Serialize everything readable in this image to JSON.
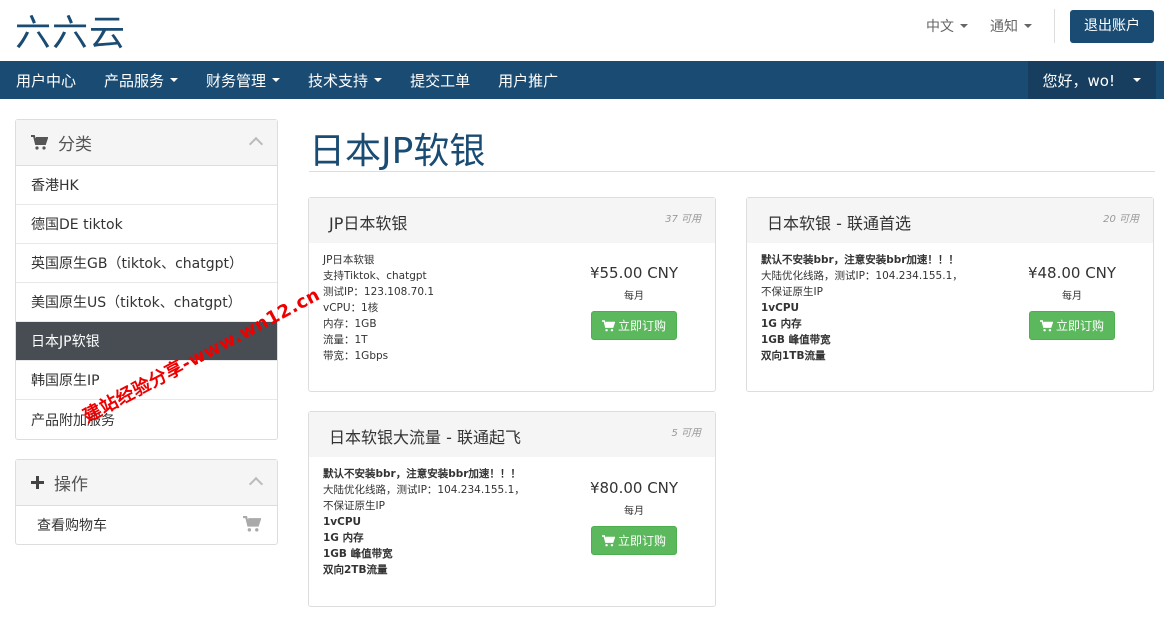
{
  "header": {
    "logo": "六六云",
    "language": "中文",
    "notifications": "通知",
    "logout": "退出账户"
  },
  "nav": {
    "items": [
      {
        "label": "用户中心",
        "dropdown": false
      },
      {
        "label": "产品服务",
        "dropdown": true
      },
      {
        "label": "财务管理",
        "dropdown": true
      },
      {
        "label": "技术支持",
        "dropdown": true
      },
      {
        "label": "提交工单",
        "dropdown": false
      },
      {
        "label": "用户推广",
        "dropdown": false
      }
    ],
    "greeting": "您好，wo!"
  },
  "sidebar": {
    "categories_title": "分类",
    "categories": [
      "香港HK",
      "德国DE tiktok",
      "英国原生GB（tiktok、chatgpt）",
      "美国原生US（tiktok、chatgpt）",
      "日本JP软银",
      "韩国原生IP",
      "产品附加服务"
    ],
    "active_index": 4,
    "actions_title": "操作",
    "actions": [
      "查看购物车"
    ]
  },
  "main": {
    "title": "日本JP软银",
    "products": [
      {
        "name": "JP日本软银",
        "available": "37 可用",
        "desc": [
          "JP日本软银",
          "支持Tiktok、chatgpt",
          "测试IP：123.108.70.1",
          "vCPU：1核",
          "内存：1GB",
          "流量：1T",
          "带宽：1Gbps"
        ],
        "bold_first": false,
        "price": "¥55.00 CNY",
        "cycle": "每月",
        "order": "立即订购"
      },
      {
        "name": "日本软银 - 联通首选",
        "available": "20 可用",
        "desc": [
          "默认不安装bbr，注意安装bbr加速！！！",
          "大陆优化线路，测试IP：104.234.155.1，",
          "不保证原生IP",
          "1vCPU",
          "1G 内存",
          "1GB 峰值带宽",
          "双向1TB流量"
        ],
        "bold_first": true,
        "price": "¥48.00 CNY",
        "cycle": "每月",
        "order": "立即订购"
      },
      {
        "name": "日本软银大流量 - 联通起飞",
        "available": "5 可用",
        "desc": [
          "默认不安装bbr，注意安装bbr加速！！！",
          "大陆优化线路，测试IP：104.234.155.1，",
          "不保证原生IP",
          "1vCPU",
          "1G 内存",
          "1GB 峰值带宽",
          "双向2TB流量"
        ],
        "bold_first": true,
        "price": "¥80.00 CNY",
        "cycle": "每月",
        "order": "立即订购"
      }
    ]
  },
  "watermark": "建站经验分享-www.wn12.cn",
  "colors": {
    "brand": "#1a4b73",
    "active": "#474d52",
    "success": "#5cb85c"
  }
}
